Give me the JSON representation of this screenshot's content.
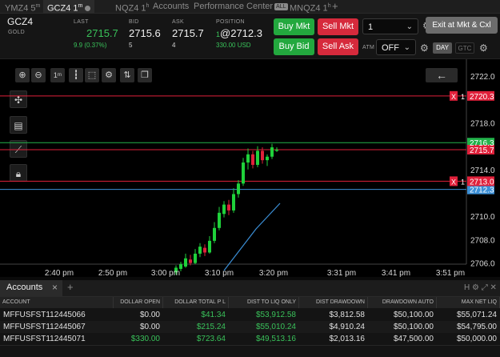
{
  "tabs": [
    {
      "label": "YMZ4 5",
      "sup": "m"
    },
    {
      "label": "GCZ4 1",
      "sup": "m"
    },
    {
      "label": "NQZ4 1",
      "sup": "h"
    },
    {
      "label": "Accounts"
    },
    {
      "label": "Performance Center",
      "badge": "ALL"
    },
    {
      "label": "MNQZ4 1",
      "sup": "h"
    }
  ],
  "add_tab": "+",
  "quote": {
    "symbol": "GCZ4",
    "exchange": "GOLD",
    "last_label": "LAST",
    "last": "2715.7",
    "change": "9.9 (0.37%)",
    "bid_label": "BID",
    "bid": "2715.6",
    "bid_size": "5",
    "ask_label": "ASK",
    "ask": "2715.7",
    "ask_size": "4",
    "position_label": "POSITION",
    "position_qty": "1",
    "position_price": "@2712.3",
    "position_pnl": "330.00 USD"
  },
  "order": {
    "buy_mkt": "Buy Mkt",
    "sell_mkt": "Sell Mkt",
    "buy_bid": "Buy Bid",
    "sell_ask": "Sell Ask",
    "quantity": "1",
    "exit": "Exit at Mkt & Cxl",
    "atm_label": "ATM",
    "atm_value": "OFF",
    "tif_day": "DAY",
    "tif_gtc": "GTC"
  },
  "chart": {
    "back_icon": "←",
    "price_labels": [
      {
        "price": 2722.0,
        "text": "2722.0"
      },
      {
        "price": 2718.0,
        "text": "2718.0"
      },
      {
        "price": 2714.0,
        "text": "2714.0"
      },
      {
        "price": 2710.0,
        "text": "2710.0"
      },
      {
        "price": 2708.0,
        "text": "2708.0"
      },
      {
        "price": 2706.0,
        "text": "2706.0"
      }
    ],
    "time_labels": [
      "2:40 pm",
      "2:50 pm",
      "3:00 pm",
      "3:10 pm",
      "3:20 pm",
      "3:31 pm",
      "3:41 pm",
      "3:51 pm"
    ],
    "order_lines": [
      {
        "price": 2720.3,
        "text": "2720.3",
        "qty": "1",
        "x": "X",
        "color": "#e0203a"
      },
      {
        "price": 2713.0,
        "text": "2713.0",
        "qty": "1",
        "x": "X",
        "color": "#e0203a"
      }
    ],
    "market_lines": [
      {
        "price": 2716.3,
        "text": "2716.3",
        "color": "#22b24a"
      },
      {
        "price": 2715.7,
        "text": "2715.7",
        "color": "#e0203a"
      },
      {
        "price": 2712.3,
        "text": "2712.3",
        "color": "#3b8fd6"
      }
    ]
  },
  "accounts": {
    "title": "Accounts",
    "close": "×",
    "add": "+",
    "columns": [
      "ACCOUNT",
      "DOLLAR OPEN",
      "DOLLAR TOTAL P L",
      "DIST TO LIQ ONLY",
      "DIST DRAWDOWN",
      "DRAWDOWN AUTO",
      "MAX NET LIQ"
    ],
    "rows": [
      [
        "MFFUSFST112445066",
        "$0.00",
        "$41.34",
        "$53,912.58",
        "$3,812.58",
        "$50,100.00",
        "$55,071.24"
      ],
      [
        "MFFUSFST112445067",
        "$0.00",
        "$215.24",
        "$55,010.24",
        "$4,910.24",
        "$50,100.00",
        "$54,795.00"
      ],
      [
        "MFFUSFST112445071",
        "$330.00",
        "$723.64",
        "$49,513.16",
        "$2,013.16",
        "$47,500.00",
        "$50,000.00"
      ]
    ],
    "green_cols": [
      2,
      3
    ]
  }
}
